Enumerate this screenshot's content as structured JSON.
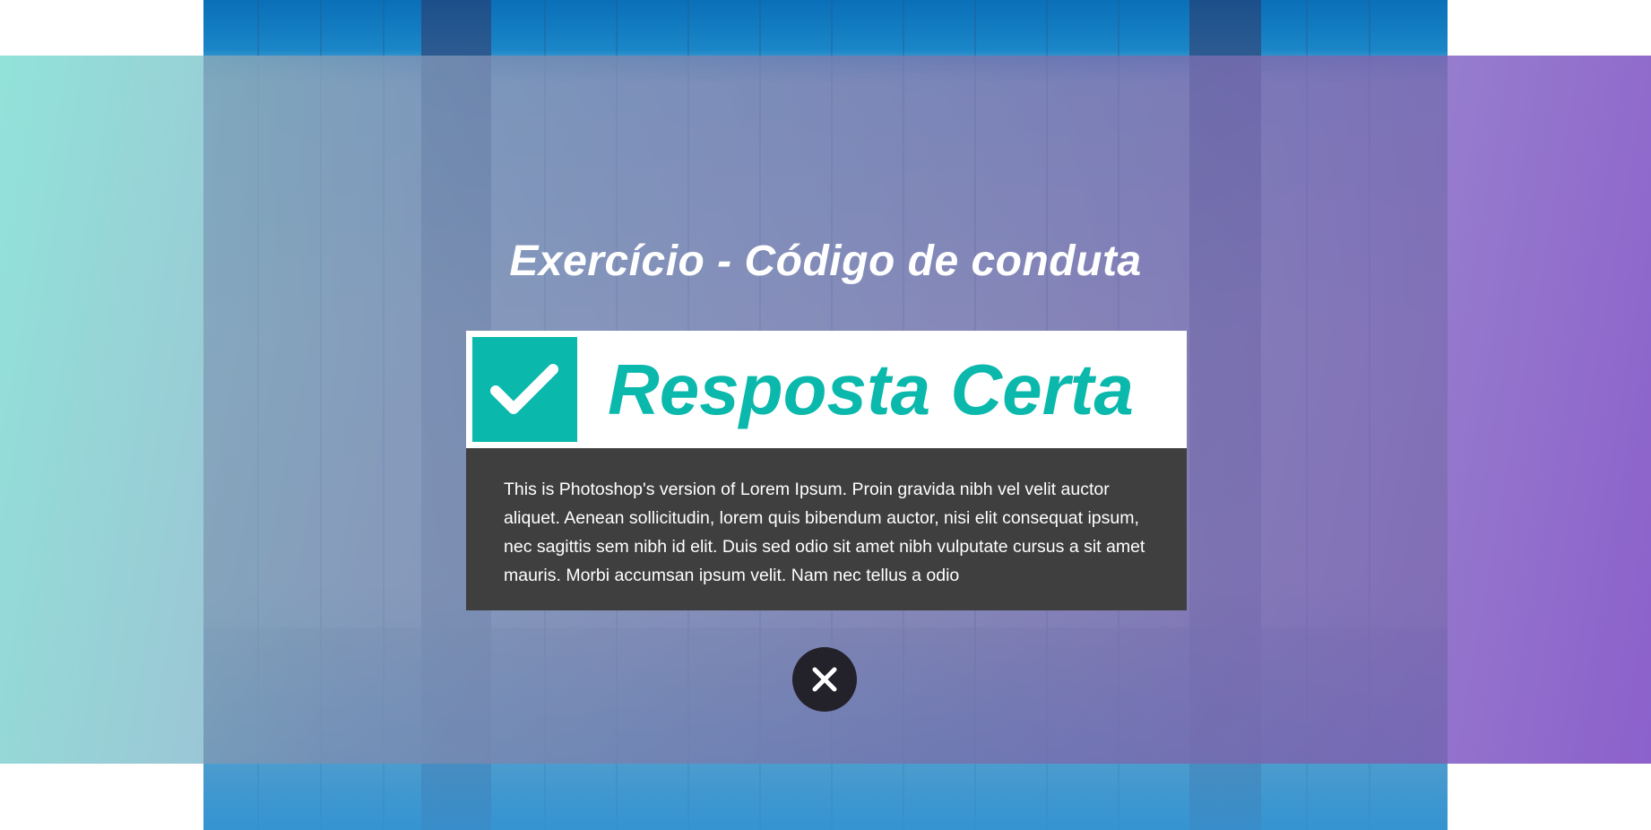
{
  "page": {
    "title": "Exercício - Código de conduta"
  },
  "result": {
    "label": "Resposta Certa",
    "icon": "checkmark-icon",
    "accent_color": "#0ab8ac"
  },
  "feedback": {
    "text": "This is Photoshop's version  of Lorem Ipsum. Proin gravida nibh vel velit auctor aliquet. Aenean sollicitudin, lorem quis bibendum auctor, nisi elit consequat ipsum, nec sagittis sem nibh id elit. Duis sed odio sit amet nibh vulputate cursus a sit amet mauris. Morbi accumsan ipsum velit. Nam nec tellus a odio"
  },
  "close_button": {
    "icon": "close-icon"
  }
}
